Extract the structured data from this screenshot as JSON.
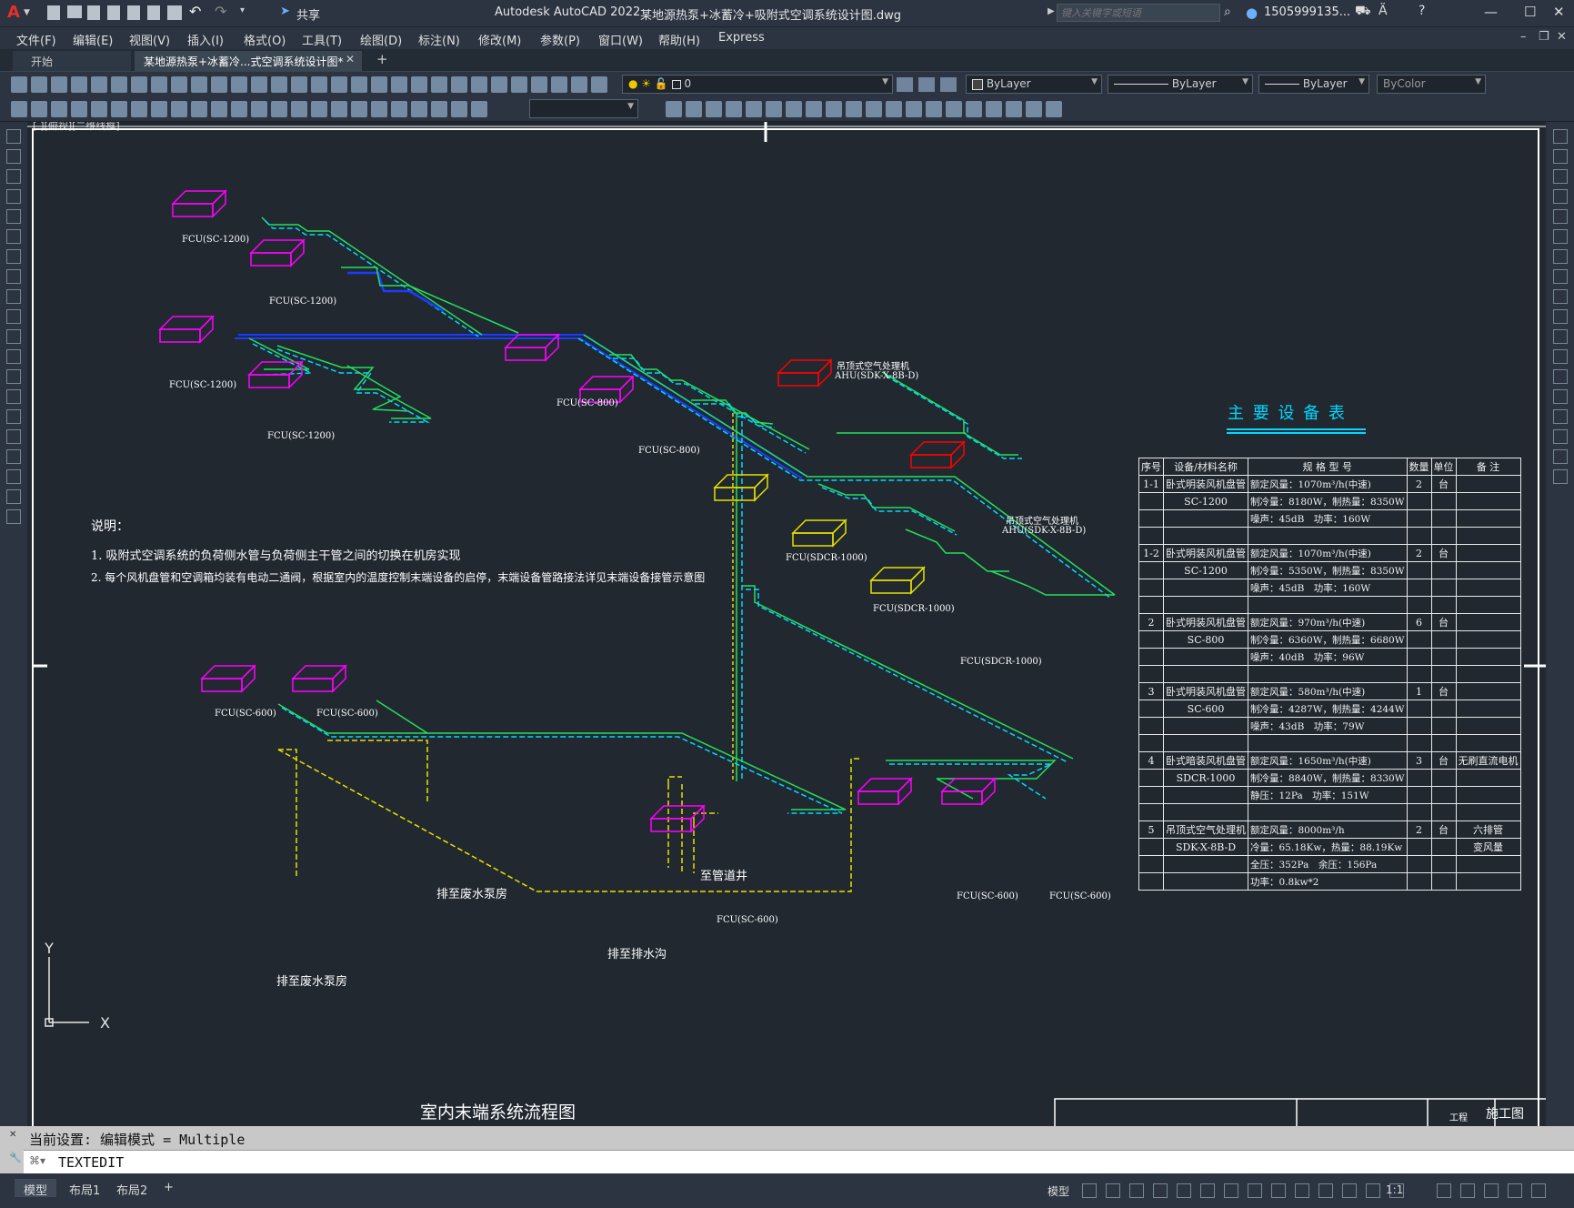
{
  "app": {
    "title": "Autodesk AutoCAD 2022",
    "document": "某地源热泵+冰蓄冷+吸附式空调系统设计图.dwg",
    "share_label": "共享",
    "search_placeholder": "键入关键字或短语",
    "user": "1505999135...",
    "logo": "A"
  },
  "menu": [
    "文件(F)",
    "编辑(E)",
    "视图(V)",
    "插入(I)",
    "格式(O)",
    "工具(T)",
    "绘图(D)",
    "标注(N)",
    "修改(M)",
    "参数(P)",
    "窗口(W)",
    "帮助(H)",
    "Express"
  ],
  "tabs": [
    {
      "label": "开始"
    },
    {
      "label": "某地源热泵+冰蓄冷...式空调系统设计图*"
    },
    {
      "label": "+"
    }
  ],
  "properties": {
    "layer": "0",
    "color": "ByLayer",
    "linetype": "ByLayer",
    "lineweight": "ByLayer",
    "plotstyle": "ByColor"
  },
  "viewport_label": "[-][俯视][二维线框]",
  "notes": {
    "heading": "说明：",
    "items": [
      "1. 吸附式空调系统的负荷侧水管与负荷侧主干管之间的切换在机房实现",
      "2. 每个风机盘管和空调箱均装有电动二通阀，根据室内的温度控制末端设备的启停，末端设备管路接法详见末端设备接管示意图"
    ]
  },
  "drawing_title": "室内末端系统流程图",
  "labels": {
    "fcu1200": "FCU(SC-1200)",
    "fcu800": "FCU(SC-800)",
    "fcu600": "FCU(SC-600)",
    "fcusdcr": "FCU(SDCR-1000)",
    "ahu_top": "吊顶式空气处理机",
    "ahu_top2": "AHU(SDK-X-8B-D)",
    "ahu_bottom": "吊顶式空气处理机",
    "ahu_bottom2": "AHU(SDK-X-8B-D)",
    "drain1": "排至废水泵房",
    "drain2": "排至废水泵房",
    "drain3": "排至排水沟",
    "riser": "至管道井"
  },
  "equipment_table": {
    "title": "主 要 设 备 表",
    "headers": [
      "序号",
      "设备/材料名称",
      "规 格 型 号",
      "数量",
      "单位",
      "备 注"
    ],
    "rows": [
      [
        "1-1",
        "卧式明装风机盘管",
        "额定风量：1070m³/h(中速)",
        "2",
        "台",
        ""
      ],
      [
        "",
        "SC-1200",
        "制冷量：8180W，制热量：8350W",
        "",
        "",
        ""
      ],
      [
        "",
        "",
        "噪声：45dB　功率：160W",
        "",
        "",
        ""
      ],
      [
        "",
        "",
        "",
        "",
        "",
        ""
      ],
      [
        "1-2",
        "卧式明装风机盘管",
        "额定风量：1070m³/h(中速)",
        "2",
        "台",
        ""
      ],
      [
        "",
        "SC-1200",
        "制冷量：5350W，制热量：8350W",
        "",
        "",
        ""
      ],
      [
        "",
        "",
        "噪声：45dB　功率：160W",
        "",
        "",
        ""
      ],
      [
        "",
        "",
        "",
        "",
        "",
        ""
      ],
      [
        "2",
        "卧式明装风机盘管",
        "额定风量：970m³/h(中速)",
        "6",
        "台",
        ""
      ],
      [
        "",
        "SC-800",
        "制冷量：6360W，制热量：6680W",
        "",
        "",
        ""
      ],
      [
        "",
        "",
        "噪声：40dB　功率：96W",
        "",
        "",
        ""
      ],
      [
        "",
        "",
        "",
        "",
        "",
        ""
      ],
      [
        "3",
        "卧式明装风机盘管",
        "额定风量：580m³/h(中速)",
        "1",
        "台",
        ""
      ],
      [
        "",
        "SC-600",
        "制冷量：4287W，制热量：4244W",
        "",
        "",
        ""
      ],
      [
        "",
        "",
        "噪声：43dB　功率：79W",
        "",
        "",
        ""
      ],
      [
        "",
        "",
        "",
        "",
        "",
        ""
      ],
      [
        "4",
        "卧式暗装风机盘管",
        "额定风量：1650m³/h(中速)",
        "3",
        "台",
        "无刷直流电机"
      ],
      [
        "",
        "SDCR-1000",
        "制冷量：8840W，制热量：8330W",
        "",
        "",
        ""
      ],
      [
        "",
        "",
        "静压：12Pa　功率：151W",
        "",
        "",
        ""
      ],
      [
        "",
        "",
        "",
        "",
        "",
        ""
      ],
      [
        "5",
        "吊顶式空气处理机",
        "额定风量：8000m³/h",
        "2",
        "台",
        "六排管"
      ],
      [
        "",
        "SDK-X-8B-D",
        "冷量：65.18Kw，热量：88.19Kw",
        "",
        "",
        "变风量"
      ],
      [
        "",
        "",
        "全压：352Pa　余压：156Pa",
        "",
        "",
        ""
      ],
      [
        "",
        "",
        "功率：0.8kw*2",
        "",
        "",
        ""
      ]
    ]
  },
  "titleblock": {
    "stage": "施工图",
    "code": "工程"
  },
  "command": {
    "history": "当前设置: 编辑模式 = Multiple",
    "current": "TEXTEDIT"
  },
  "layout_tabs": [
    "模型",
    "布局1",
    "布局2",
    "+"
  ],
  "status": {
    "model": "模型",
    "scale": "1:1"
  },
  "colors": {
    "supply": "#24e05a",
    "return": "#00d8ff",
    "condensate": "#e6e000",
    "main_blue": "#1a3cff",
    "fcu": "#ff00ff",
    "fcu_sdcr": "#e6e000",
    "ahu": "#ff0000"
  }
}
